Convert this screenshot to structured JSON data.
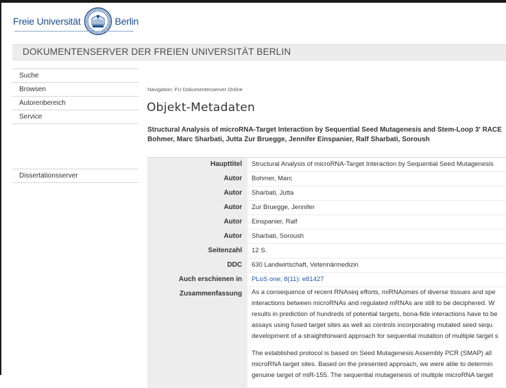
{
  "header": {
    "logo_left": "Freie Universität",
    "logo_right": "Berlin",
    "band_title": "DOKUMENTENSERVER DER FREIEN UNIVERSITÄT BERLIN"
  },
  "sidebar": {
    "items": [
      {
        "label": "Suche"
      },
      {
        "label": "Browsen"
      },
      {
        "label": "Autorenbereich"
      },
      {
        "label": "Service"
      }
    ],
    "items2": [
      {
        "label": "Dissertationsserver"
      }
    ]
  },
  "navigation": {
    "prefix": "Navigation:",
    "link": "FU Dokumentenserver Online"
  },
  "page": {
    "title": "Objekt-Metadaten",
    "work_title_line1": "Structural Analysis of microRNA-Target Interaction by Sequential Seed Mutagenesis and Stem-Loop 3' RACE",
    "work_title_line2": "Bohmer, Marc Sharbati, Jutta Zur Bruegge, Jennifer Einspanier, Ralf Sharbati, Soroush"
  },
  "metadata": {
    "haupttitel": {
      "label": "Haupttitel",
      "value": "Structural Analysis of microRNA-Target Interaction by Sequential Seed Mutagenesis"
    },
    "autor1": {
      "label": "Autor",
      "value": "Bohmer, Marc"
    },
    "autor2": {
      "label": "Autor",
      "value": "Sharbati, Jutta"
    },
    "autor3": {
      "label": "Autor",
      "value": "Zur Bruegge, Jennifer"
    },
    "autor4": {
      "label": "Autor",
      "value": "Einspanier, Ralf"
    },
    "autor5": {
      "label": "Autor",
      "value": "Sharbati, Soroush"
    },
    "seitenzahl": {
      "label": "Seitenzahl",
      "value": "12 S."
    },
    "ddc": {
      "label": "DDC",
      "value": "630 Landwirtschaft, Veterinärmedizin"
    },
    "auch": {
      "label": "Auch erschienen in",
      "value": "PLoS one; 8(11): e81427"
    },
    "zusammenfassung": {
      "label": "Zusammenfassung",
      "p1_l1": "As a consequence of recent RNAseq efforts, miRNAomes of diverse tissues and spe",
      "p1_l2": "interactions between microRNAs and regulated mRNAs are still to be deciphered. W",
      "p1_l3": "results in prediction of hundreds of potential targets, bona-fide interactions have to be",
      "p1_l4": "assays using fused target sites as well as controls incorporating mutated seed sequ",
      "p1_l5": "development of a straightforward approach for sequential mutation of multiple target s",
      "p2_l1": "The established protocol is based on Seed Mutagenesis Assembly PCR (SMAP) all",
      "p2_l2": "microRNA target sites. Based on the presented approach, we were able to determin",
      "p2_l3": "genuine target of miR-155. The sequential mutagenesis of multiple microRNA target"
    }
  }
}
